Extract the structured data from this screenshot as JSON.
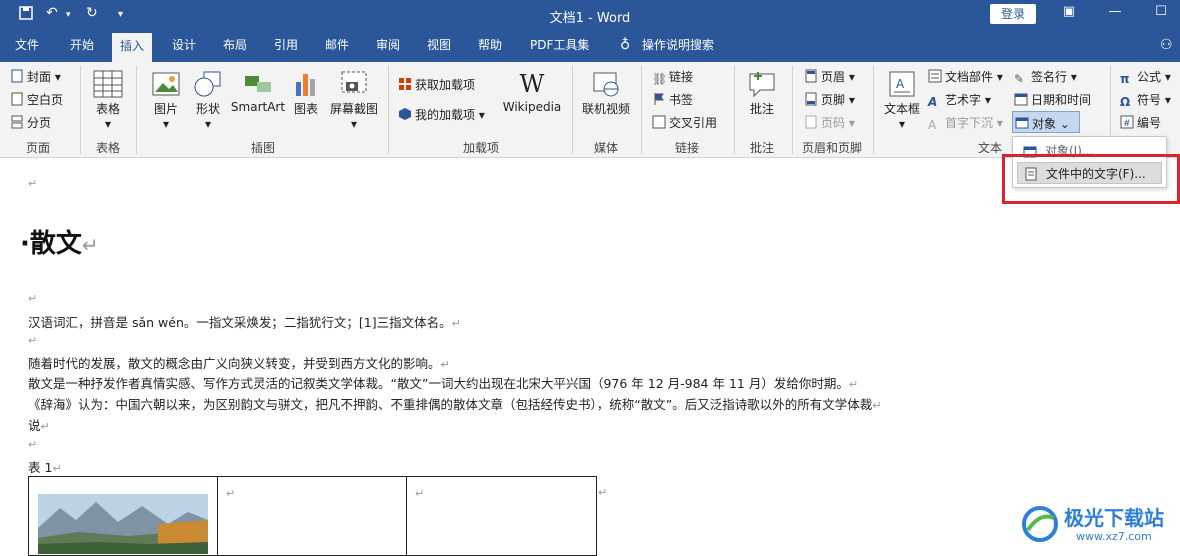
{
  "window": {
    "title": "文档1 - Word",
    "login": "登录"
  },
  "tabs": [
    "文件",
    "开始",
    "插入",
    "设计",
    "布局",
    "引用",
    "邮件",
    "审阅",
    "视图",
    "帮助",
    "PDF工具集",
    "操作说明搜索"
  ],
  "ribbon": {
    "pages": {
      "cover": "封面",
      "blank": "空白页",
      "break": "分页",
      "group": "页面"
    },
    "tables": {
      "table": "表格",
      "group": "表格"
    },
    "illustrations": {
      "picture": "图片",
      "shape": "形状",
      "smartart": "SmartArt",
      "chart": "图表",
      "screenshot": "屏幕截图",
      "group": "插图"
    },
    "addins": {
      "get": "获取加载项",
      "my": "我的加载项",
      "wikipedia": "Wikipedia",
      "group": "加载项"
    },
    "media": {
      "video": "联机视频",
      "group": "媒体"
    },
    "links": {
      "link": "链接",
      "bookmark": "书签",
      "crossref": "交叉引用",
      "group": "链接"
    },
    "comments": {
      "comment": "批注",
      "group": "批注"
    },
    "headerfooter": {
      "header": "页眉",
      "footer": "页脚",
      "pagenum": "页码",
      "group": "页眉和页脚"
    },
    "text": {
      "textbox": "文本框",
      "parts": "文档部件",
      "wordart": "艺术字",
      "dropcap": "首字下沉",
      "signature": "签名行",
      "datetime": "日期和时间",
      "object": "对象",
      "group": "文本"
    },
    "symbols": {
      "equation": "公式",
      "symbol": "符号",
      "number": "编号"
    }
  },
  "dropdown": {
    "item1": "对象(J)...",
    "item2": "文件中的文字(F)..."
  },
  "document": {
    "heading": "散文",
    "p1": "汉语词汇，拼音是 sǎn wén。一指文采焕发；二指犹行文；[1]三指文体名。",
    "p2": "随着时代的发展，散文的概念由广义向狭义转变，并受到西方文化的影响。",
    "p3": "散文是一种抒发作者真情实感、写作方式灵活的记叙类文学体裁。“散文”一词大约出现在北宋大平兴国（976 年 12 月-984 年 11 月）发给你时期。",
    "p4": "《辞海》认为：中国六朝以来，为区别韵文与骈文，把凡不押韵、不重排偶的散体文章（包括经传史书），统称“散文”。后又泛指诗歌以外的所有文学体裁",
    "p5": "说",
    "caption": "表 1",
    "mark": "↵"
  },
  "watermark": {
    "text": "极光下载站",
    "url": "www.xz7.com"
  }
}
